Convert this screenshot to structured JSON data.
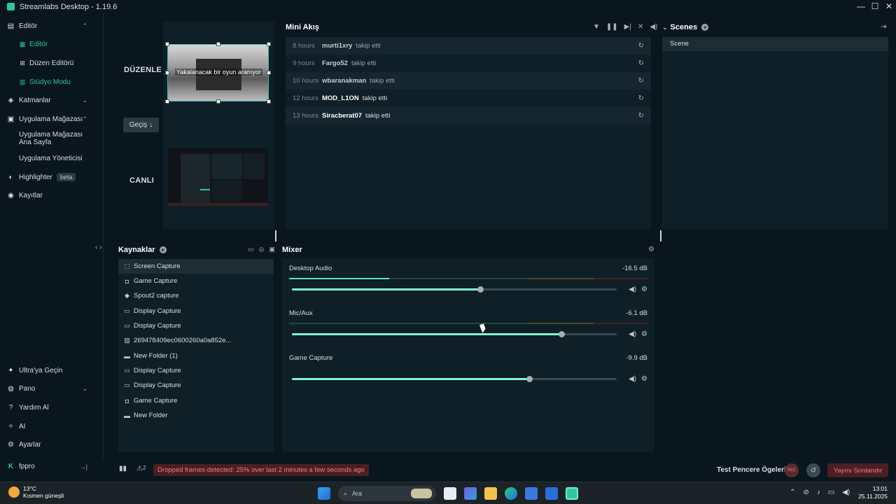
{
  "window": {
    "title": "Streamlabs Desktop - 1.19.6",
    "controls": [
      "—",
      "☐",
      "✕"
    ]
  },
  "sidebar": {
    "editor": "Editör",
    "editor_sub": [
      {
        "label": "Editör",
        "icon": "editor-icon"
      },
      {
        "label": "Düzen Editörü",
        "icon": "layout-editor-icon"
      },
      {
        "label": "Stüdyo Modu",
        "icon": "studio-mode-icon"
      }
    ],
    "layers": "Katmanlar",
    "app_store": "Uygulama Mağazası",
    "app_store_sub": [
      "Uygulama Mağazası Ana Sayfa",
      "Uygulama Yöneticisi"
    ],
    "highlighter": "Highlighter",
    "highlighter_badge": "beta",
    "recordings": "Kayıtlar",
    "ultra": "Ultra'ya Geçin",
    "dashboard": "Pano",
    "help": "Yardım Al",
    "ai": "AI",
    "settings": "Ayarlar",
    "user": "fppro"
  },
  "studio": {
    "edit_label": "DÜZENLE",
    "live_label": "CANLI",
    "transition_label": "Geçiş",
    "preview_caption": "Yakalanacak bir oyun aranıyor"
  },
  "mini_feed": {
    "title": "Mini Akış",
    "rows": [
      {
        "time": "8 hours",
        "user": "murti1xry",
        "action": "takip etti"
      },
      {
        "time": "9 hours",
        "user": "Fargo52",
        "action": "takip etti"
      },
      {
        "time": "10 hours",
        "user": "wbaranakman",
        "action": "takip etti"
      },
      {
        "time": "12 hours",
        "user": "MOD_L1ON",
        "action": "takip etti"
      },
      {
        "time": "13 hours",
        "user": "Siracberat07",
        "action": "takip etti"
      }
    ]
  },
  "scenes": {
    "title": "Scenes",
    "items": [
      "Scene"
    ]
  },
  "sources": {
    "title": "Kaynaklar",
    "items": [
      {
        "label": "Screen Capture",
        "icon": "screen-capture-icon"
      },
      {
        "label": "Game Capture",
        "icon": "gamepad-icon"
      },
      {
        "label": "Spout2 capture",
        "icon": "shield-icon"
      },
      {
        "label": "Display Capture",
        "icon": "monitor-icon"
      },
      {
        "label": "Display Capture",
        "icon": "monitor-icon"
      },
      {
        "label": "269478409ec0600260a0a852e...",
        "icon": "image-icon"
      },
      {
        "label": "New Folder (1)",
        "icon": "folder-icon"
      },
      {
        "label": "Display Capture",
        "icon": "monitor-icon"
      },
      {
        "label": "Display Capture",
        "icon": "monitor-icon"
      },
      {
        "label": "Game Capture",
        "icon": "gamepad-icon"
      },
      {
        "label": "New Folder",
        "icon": "folder-icon"
      }
    ]
  },
  "mixer": {
    "title": "Mixer",
    "channels": [
      {
        "name": "Desktop Audio",
        "db": "-16.5 dB",
        "volume": 0.58,
        "level": 0.28
      },
      {
        "name": "Mic/Aux",
        "db": "-6.1 dB",
        "volume": 0.83,
        "level": 0.0
      },
      {
        "name": "Game Capture",
        "db": "-9.9 dB",
        "volume": 0.73,
        "level": 0.0
      }
    ]
  },
  "footer": {
    "warning_count": "2",
    "dropped_frames": "Dropped frames detected: 25% over last 2 minutes a few seconds ago",
    "test_items": "Test Pencere Ögeleri",
    "rec_label": "REC",
    "stop_stream": "Yayını Sonlandır"
  },
  "taskbar": {
    "temperature": "13°C",
    "weather": "Kısmen güneşli",
    "search_placeholder": "Ara",
    "time": "13:01",
    "date": "25.11.2025"
  },
  "colors": {
    "accent": "#31c3a2",
    "background": "#09161d",
    "panel": "#0f1f27",
    "danger": "#f37c84"
  }
}
